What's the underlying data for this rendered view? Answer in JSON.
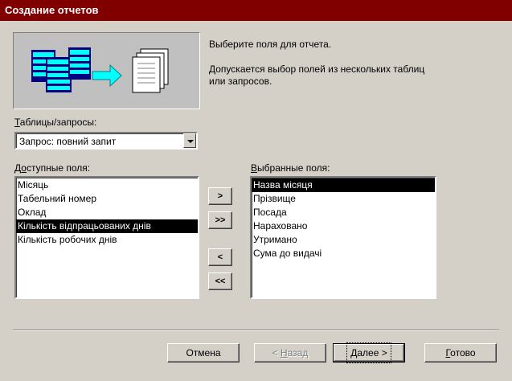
{
  "window": {
    "title": "Создание отчетов"
  },
  "intro": {
    "line1": "Выберите поля для отчета.",
    "line2": "Допускается выбор полей из нескольких таблиц",
    "line3": "или запросов."
  },
  "tables": {
    "label_u": "Т",
    "label_rest": "аблицы/запросы:",
    "selected": "Запрос: повний запит"
  },
  "available": {
    "label_pre": "Д",
    "label_u": "о",
    "label_rest": "ступные поля:",
    "items": [
      "Місяць",
      "Табельний номер",
      "Оклад",
      "Кількість відпрацьованих днів",
      "Кількість робочих днів"
    ],
    "selected_index": 3
  },
  "selected_fields": {
    "label_u": "В",
    "label_rest": "ыбранные поля:",
    "items": [
      "Назва місяця",
      "Прізвище",
      "Посада",
      "Нараховано",
      "Утримано",
      "Сума до видачі"
    ],
    "selected_index": 0
  },
  "move_buttons": {
    "add_one": ">",
    "add_all": ">>",
    "remove_one": "<",
    "remove_all": "<<"
  },
  "footer": {
    "cancel": "Отмена",
    "back_pre": "< ",
    "back_u": "Н",
    "back_rest": "азад",
    "next_u": "Д",
    "next_rest": "алее >",
    "finish_u": "Г",
    "finish_rest": "отово"
  }
}
